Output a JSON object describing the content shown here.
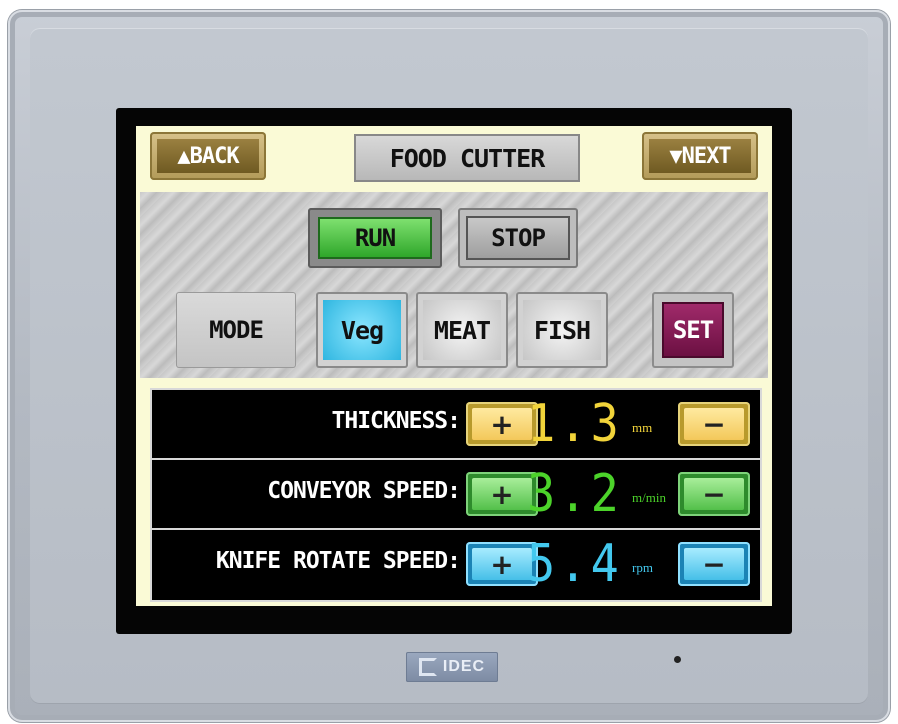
{
  "screen": {
    "back_label": "▲BACK",
    "title": "FOOD CUTTER",
    "next_label": "▼NEXT",
    "run_label": "RUN",
    "stop_label": "STOP",
    "mode_label": "MODE",
    "mode_options": [
      "Veg",
      "MEAT",
      "FISH"
    ],
    "mode_selected": "Veg",
    "set_label": "SET"
  },
  "params": [
    {
      "label": "THICKNESS:",
      "plus": "+",
      "value": "1.3",
      "unit": "mm",
      "minus": "−",
      "color": "#f2d43a",
      "theme": "yellow"
    },
    {
      "label": "CONVEYOR SPEED:",
      "plus": "+",
      "value": "3.2",
      "unit": "m/min",
      "minus": "−",
      "color": "#4cd32a",
      "theme": "green"
    },
    {
      "label": "KNIFE ROTATE SPEED:",
      "plus": "+",
      "value": "5.4",
      "unit": "rpm",
      "minus": "−",
      "color": "#43c8ee",
      "theme": "blue"
    }
  ],
  "device": {
    "brand": "IDEC"
  }
}
